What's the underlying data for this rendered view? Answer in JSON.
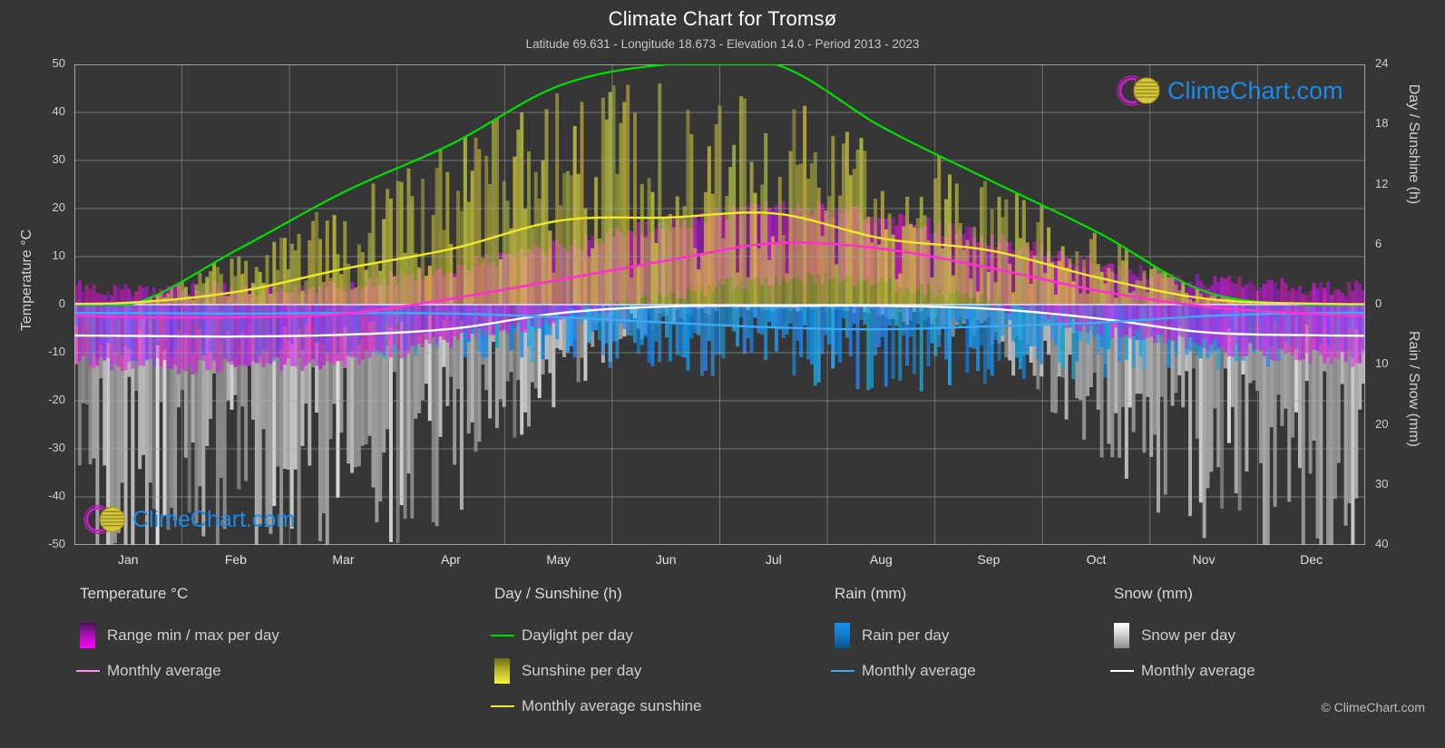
{
  "header": {
    "title": "Climate Chart for Tromsø",
    "subtitle": "Latitude 69.631 - Longitude 18.673 - Elevation 14.0 - Period 2013 - 2023"
  },
  "axes": {
    "y_left_title": "Temperature °C",
    "y_right_top_title": "Day / Sunshine (h)",
    "y_right_bottom_title": "Rain / Snow (mm)",
    "y_left_ticks": [
      "50",
      "40",
      "30",
      "20",
      "10",
      "0",
      "-10",
      "-20",
      "-30",
      "-40",
      "-50"
    ],
    "y_right_ticks": [
      "24",
      "18",
      "12",
      "6",
      "0",
      "10",
      "20",
      "30",
      "40"
    ],
    "x_ticks": [
      "Jan",
      "Feb",
      "Mar",
      "Apr",
      "May",
      "Jun",
      "Jul",
      "Aug",
      "Sep",
      "Oct",
      "Nov",
      "Dec"
    ]
  },
  "logo": {
    "text": "ClimeChart.com"
  },
  "footer": {
    "credit": "© ClimeChart.com"
  },
  "legend": {
    "groups": [
      {
        "title": "Temperature °C",
        "items": [
          {
            "label": "Range min / max per day",
            "marker": "gradient",
            "color": "#ff00ff"
          },
          {
            "label": "Monthly average",
            "marker": "line",
            "color": "#ff8fe0"
          }
        ]
      },
      {
        "title": "Day / Sunshine (h)",
        "items": [
          {
            "label": "Daylight per day",
            "marker": "line",
            "color": "#00e000"
          },
          {
            "label": "Sunshine per day",
            "marker": "gradient",
            "color": "#f7f53c"
          },
          {
            "label": "Monthly average sunshine",
            "marker": "line",
            "color": "#eeea2a"
          }
        ]
      },
      {
        "title": "Rain (mm)",
        "items": [
          {
            "label": "Rain per day",
            "marker": "gradient",
            "color": "#1492ef"
          },
          {
            "label": "Monthly average",
            "marker": "line",
            "color": "#3fa9f5"
          }
        ]
      },
      {
        "title": "Snow (mm)",
        "items": [
          {
            "label": "Snow per day",
            "marker": "gradient",
            "color": "#ffffff"
          },
          {
            "label": "Monthly average",
            "marker": "line",
            "color": "#ffffff"
          }
        ]
      }
    ]
  },
  "chart_data": {
    "type": "line",
    "title": "Climate Chart for Tromsø",
    "subtitle": "Latitude 69.631 - Longitude 18.673 - Elevation 14.0 - Period 2013 - 2023",
    "xlabel": "",
    "ylabel": "Temperature °C",
    "ylabel_right_top": "Day / Sunshine (h)",
    "ylabel_right_bottom": "Rain / Snow (mm)",
    "ylim": [
      -50,
      50
    ],
    "ylim_right_top": [
      0,
      24
    ],
    "ylim_right_bottom": [
      0,
      40
    ],
    "grid": true,
    "legend_position": "below",
    "categories": [
      "Jan",
      "Feb",
      "Mar",
      "Apr",
      "May",
      "Jun",
      "Jul",
      "Aug",
      "Sep",
      "Oct",
      "Nov",
      "Dec"
    ],
    "series": [
      {
        "name": "Monthly average temperature",
        "axis": "left",
        "unit": "°C",
        "color": "#ff2fd0",
        "values": [
          -2.6,
          -2.6,
          -1.9,
          1.3,
          5.2,
          9.2,
          12.8,
          11.6,
          7.6,
          2.9,
          -0.4,
          -1.9
        ]
      },
      {
        "name": "Monthly average sunshine",
        "axis": "right_top",
        "unit": "h",
        "color": "#eeea2a",
        "values": [
          0.2,
          1.3,
          3.6,
          5.6,
          8.4,
          8.7,
          9.1,
          6.6,
          5.4,
          2.7,
          0.6,
          0.1
        ]
      },
      {
        "name": "Daylight per day",
        "axis": "right_top",
        "unit": "h",
        "color": "#00e000",
        "values": [
          0.0,
          5.5,
          11.3,
          16.1,
          21.9,
          24.0,
          24.0,
          17.7,
          12.4,
          7.2,
          1.3,
          0.0
        ]
      },
      {
        "name": "Monthly average rain",
        "axis": "right_bottom",
        "unit": "mm",
        "color": "#3fa9f5",
        "values": [
          1.4,
          1.5,
          1.4,
          1.5,
          2.1,
          3.0,
          3.8,
          4.1,
          3.6,
          3.0,
          1.9,
          1.4
        ]
      },
      {
        "name": "Monthly average snow",
        "axis": "right_bottom",
        "unit": "mm",
        "color": "#ffffff",
        "values": [
          5.2,
          5.3,
          5.0,
          4.0,
          1.4,
          0.3,
          0.2,
          0.2,
          0.7,
          2.3,
          4.6,
          5.1
        ]
      },
      {
        "name": "Temperature range min per day",
        "axis": "left",
        "unit": "°C",
        "color": "#a810b4",
        "values": [
          -9.5,
          -9.8,
          -8.6,
          -4.4,
          0.4,
          4.8,
          8.4,
          7.4,
          3.2,
          -1.8,
          -5.6,
          -7.8
        ]
      },
      {
        "name": "Temperature range max per day",
        "axis": "left",
        "unit": "°C",
        "color": "#ff00ff",
        "values": [
          1.2,
          1.4,
          2.2,
          5.6,
          10.2,
          14.6,
          18.0,
          16.2,
          11.6,
          6.4,
          3.0,
          1.6
        ]
      },
      {
        "name": "Sunshine per day (max)",
        "axis": "right_top",
        "unit": "h",
        "color": "#c9c636",
        "values": [
          1.0,
          5.0,
          9.5,
          13.5,
          17.0,
          18.5,
          17.5,
          14.0,
          10.5,
          6.0,
          2.0,
          0.5
        ]
      },
      {
        "name": "Rain per day (max)",
        "axis": "right_bottom",
        "unit": "mm",
        "color": "#1492ef",
        "values": [
          9.0,
          9.0,
          8.0,
          8.0,
          9.0,
          11.0,
          12.0,
          13.0,
          12.0,
          11.0,
          10.0,
          9.0
        ]
      },
      {
        "name": "Snow per day (max)",
        "axis": "right_bottom",
        "unit": "mm",
        "color": "#cfcfcf",
        "values": [
          38.0,
          38.0,
          36.0,
          30.0,
          14.0,
          3.0,
          1.0,
          2.0,
          8.0,
          22.0,
          34.0,
          38.0
        ]
      }
    ]
  }
}
